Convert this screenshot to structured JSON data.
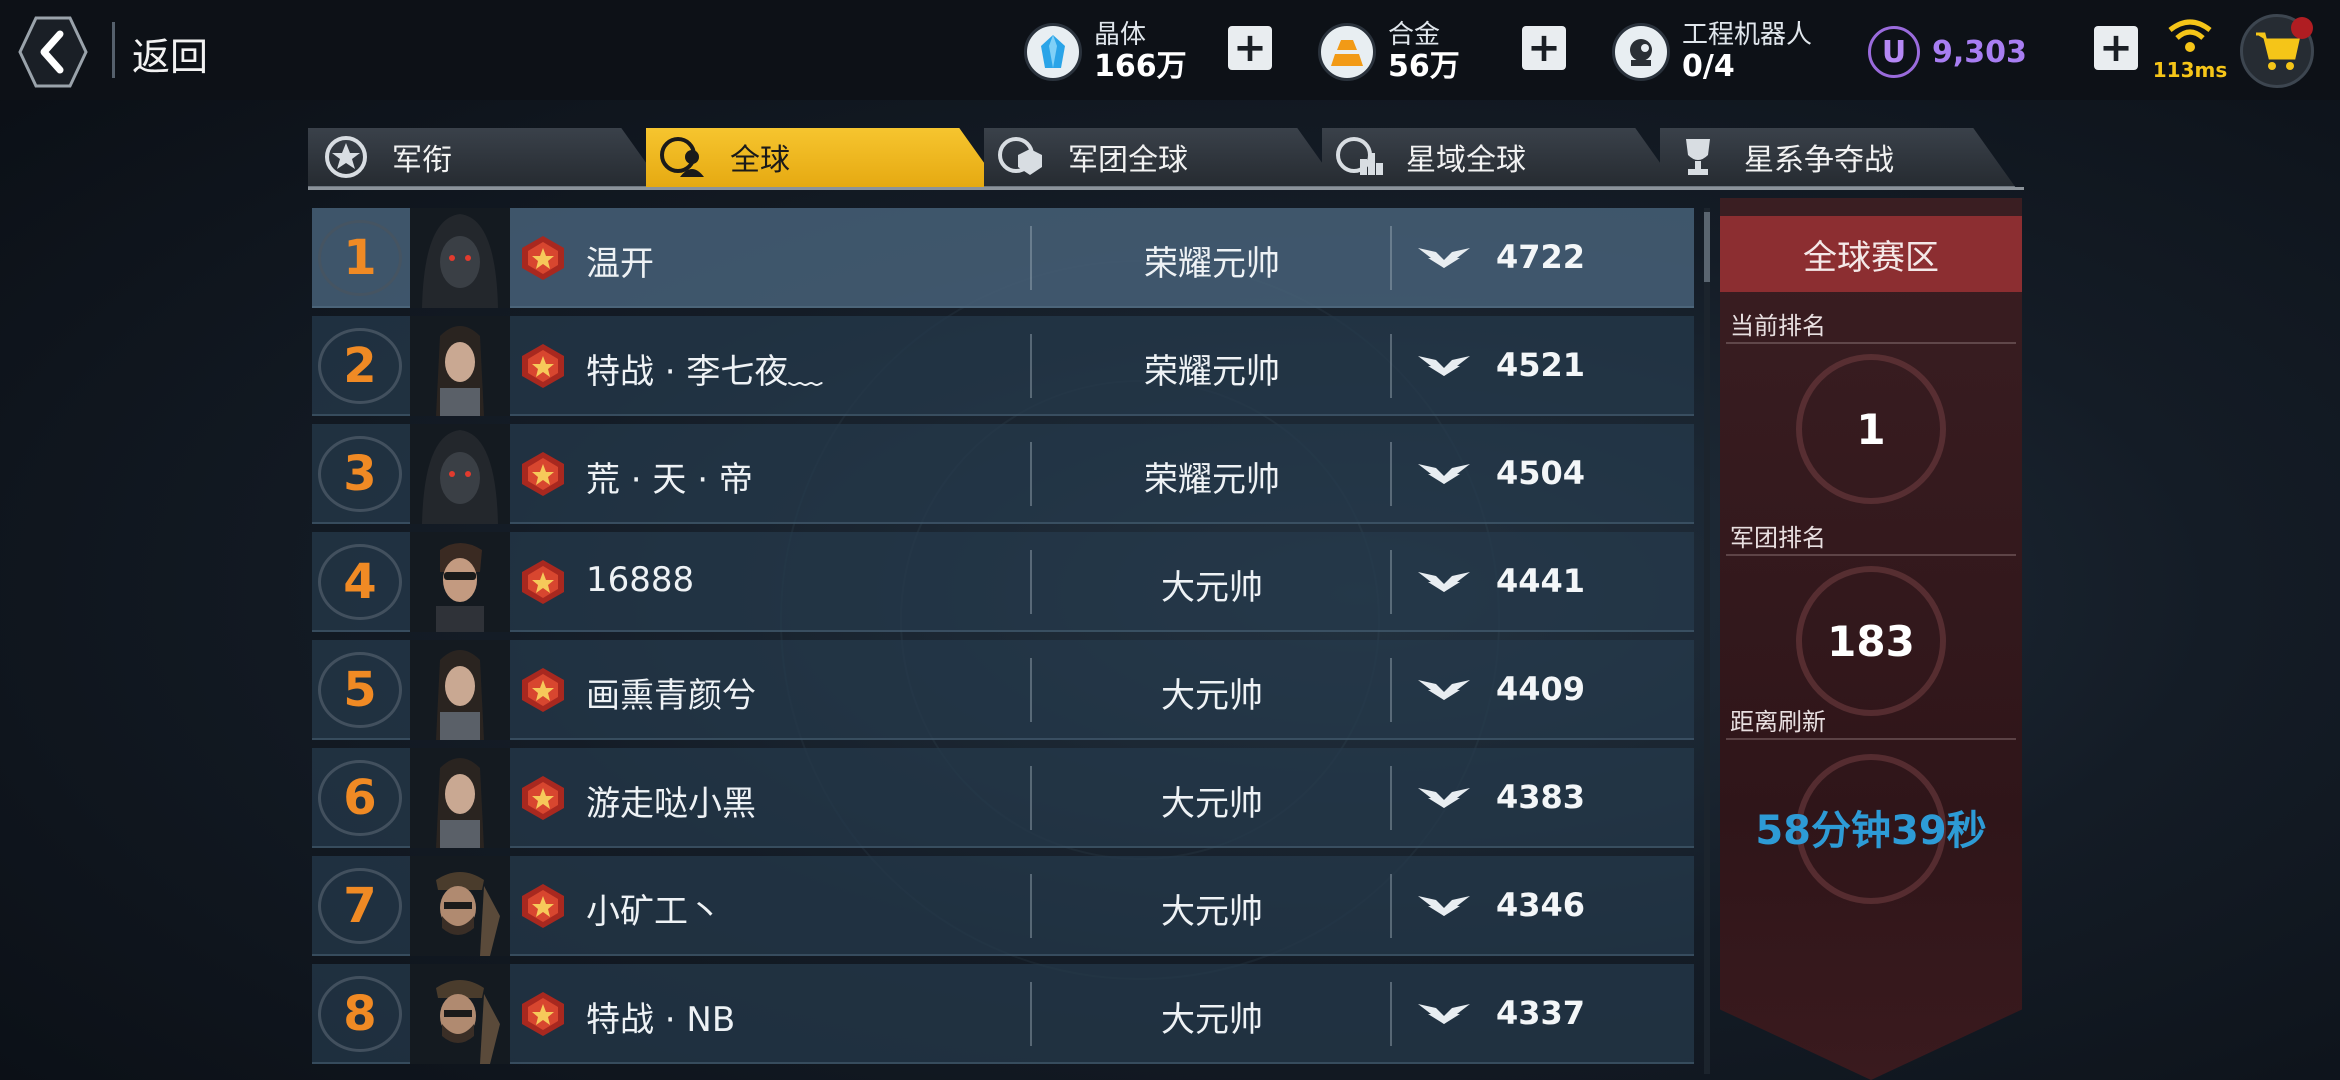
{
  "header": {
    "back_label": "返回",
    "resources": [
      {
        "label": "晶体",
        "value": "166万",
        "icon": "crystal-icon"
      },
      {
        "label": "合金",
        "value": "56万",
        "icon": "alloy-icon"
      },
      {
        "label": "工程机器人",
        "value": "0/4",
        "icon": "robot-icon"
      }
    ],
    "currency": {
      "symbol": "U",
      "value": "9,303"
    },
    "ping": "113ms"
  },
  "tabs": [
    {
      "label": "军衔",
      "icon": "rank-emblem-icon",
      "active": false
    },
    {
      "label": "全球",
      "icon": "global-player-icon",
      "active": true
    },
    {
      "label": "军团全球",
      "icon": "legion-global-icon",
      "active": false
    },
    {
      "label": "星域全球",
      "icon": "sector-global-icon",
      "active": false
    },
    {
      "label": "星系争夺战",
      "icon": "trophy-icon",
      "active": false
    }
  ],
  "rankings": [
    {
      "rank": "1",
      "name": "温开",
      "title": "荣耀元帅",
      "score": "4722",
      "avatar": "hooded-avatar"
    },
    {
      "rank": "2",
      "name": "特战 · 李七夜﹏",
      "title": "荣耀元帅",
      "score": "4521",
      "avatar": "female-avatar"
    },
    {
      "rank": "3",
      "name": "荒 · 天 · 帝",
      "title": "荣耀元帅",
      "score": "4504",
      "avatar": "hooded-avatar"
    },
    {
      "rank": "4",
      "name": "16888",
      "title": "大元帅",
      "score": "4441",
      "avatar": "sunglasses-avatar"
    },
    {
      "rank": "5",
      "name": "画熏青颜兮",
      "title": "大元帅",
      "score": "4409",
      "avatar": "female-avatar"
    },
    {
      "rank": "6",
      "name": "游走哒小黑",
      "title": "大元帅",
      "score": "4383",
      "avatar": "female-avatar"
    },
    {
      "rank": "7",
      "name": "小矿工丶",
      "title": "大元帅",
      "score": "4346",
      "avatar": "bearded-avatar"
    },
    {
      "rank": "8",
      "name": "特战 · NB",
      "title": "大元帅",
      "score": "4337",
      "avatar": "bearded-avatar"
    }
  ],
  "panel": {
    "title": "全球赛区",
    "current_rank_label": "当前排名",
    "current_rank": "1",
    "legion_rank_label": "军团排名",
    "legion_rank": "183",
    "refresh_label": "距离刷新",
    "refresh_timer": "58分钟39秒"
  },
  "colors": {
    "accent_tab": "#f6c52f",
    "rank_number": "#f08a24",
    "currency": "#a87ef2",
    "timer": "#2d9bd6",
    "panel_header": "#8c2e31"
  }
}
